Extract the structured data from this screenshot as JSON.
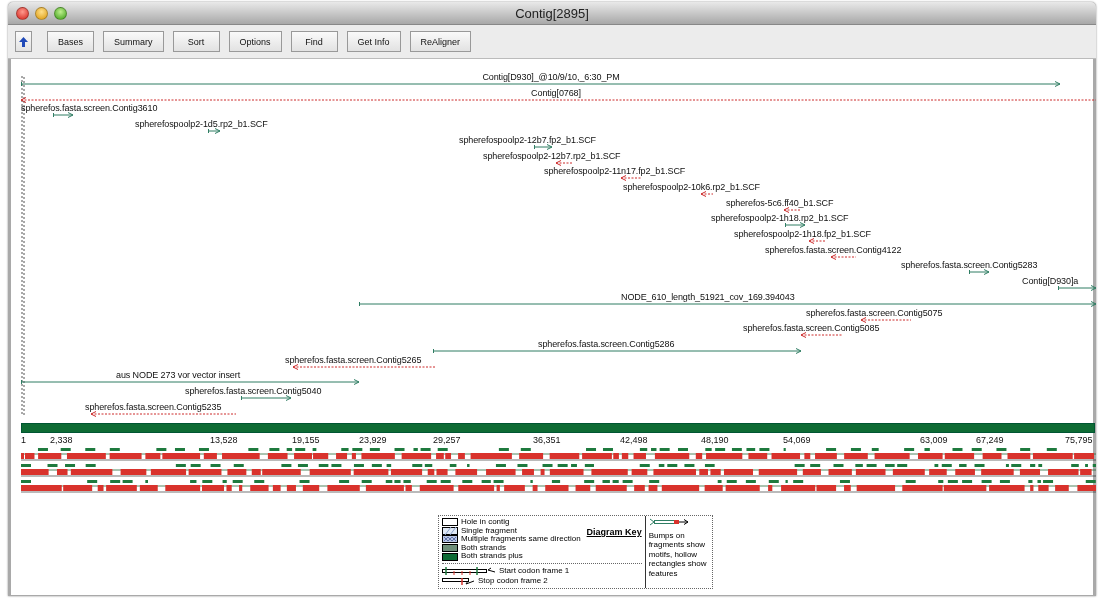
{
  "window": {
    "title": "Contig[2895]"
  },
  "toolbar": {
    "buttons": [
      "Bases",
      "Summary",
      "Sort",
      "Options",
      "Find",
      "Get Info",
      "ReAligner"
    ]
  },
  "fragments": [
    {
      "label": "Contig[D930]_@10/9/10,_6:30_PM",
      "kind": "forward"
    },
    {
      "label": "Contig[0768]",
      "kind": "reverse"
    },
    {
      "label": "spherefos.fasta.screen.Contig3610",
      "kind": "forward"
    },
    {
      "label": "spherefospoolp2-1d5.rp2_b1.SCF",
      "kind": "forward"
    },
    {
      "label": "spherefospoolp2-12b7.fp2_b1.SCF",
      "kind": "forward"
    },
    {
      "label": "spherefospoolp2-12b7.rp2_b1.SCF",
      "kind": "reverse"
    },
    {
      "label": "spherefospoolp2-11n17.fp2_b1.SCF",
      "kind": "reverse"
    },
    {
      "label": "spherefospoolp2-10k6.rp2_b1.SCF",
      "kind": "reverse"
    },
    {
      "label": "spherefos-5c6.ff40_b1.SCF",
      "kind": "reverse"
    },
    {
      "label": "spherefospoolp2-1h18.rp2_b1.SCF",
      "kind": "forward"
    },
    {
      "label": "spherefospoolp2-1h18.fp2_b1.SCF",
      "kind": "reverse"
    },
    {
      "label": "spherefos.fasta.screen.Contig4122",
      "kind": "reverse"
    },
    {
      "label": "spherefos.fasta.screen.Contig5283",
      "kind": "forward"
    },
    {
      "label": "Contig[D930]a",
      "kind": "forward"
    },
    {
      "label": "NODE_610_length_51921_cov_169.394043",
      "kind": "forward"
    },
    {
      "label": "spherefos.fasta.screen.Contig5075",
      "kind": "reverse"
    },
    {
      "label": "spherefos.fasta.screen.Contig5085",
      "kind": "reverse"
    },
    {
      "label": "spherefos.fasta.screen.Contig5286",
      "kind": "forward"
    },
    {
      "label": "spherefos.fasta.screen.Contig5265",
      "kind": "reverse"
    },
    {
      "label": "aus NODE 273 vor vector insert",
      "kind": "forward"
    },
    {
      "label": "spherefos.fasta.screen.Contig5040",
      "kind": "forward"
    },
    {
      "label": "spherefos.fasta.screen.Contig5235",
      "kind": "reverse"
    }
  ],
  "scale": {
    "ticks": [
      "1",
      "2,338",
      "13,528",
      "19,155",
      "23,929",
      "29,257",
      "36,351",
      "42,498",
      "48,190",
      "54,069",
      "63,009",
      "67,249",
      "75,795"
    ]
  },
  "legend": {
    "title": "Diagram Key",
    "entries": [
      {
        "kind": "hole",
        "label": "Hole in contig"
      },
      {
        "kind": "single",
        "label": "Single fragment"
      },
      {
        "kind": "multiple",
        "label": "Multiple fragments same direction"
      },
      {
        "kind": "both",
        "label": "Both strands"
      },
      {
        "kind": "both_plus",
        "label": "Both strands plus"
      }
    ],
    "codons": [
      {
        "kind": "start",
        "label": "Start codon frame 1"
      },
      {
        "kind": "stop",
        "label": "Stop codon frame 2"
      }
    ],
    "note": "Bumps on fragments show motifs, hollow rectangles show features"
  }
}
